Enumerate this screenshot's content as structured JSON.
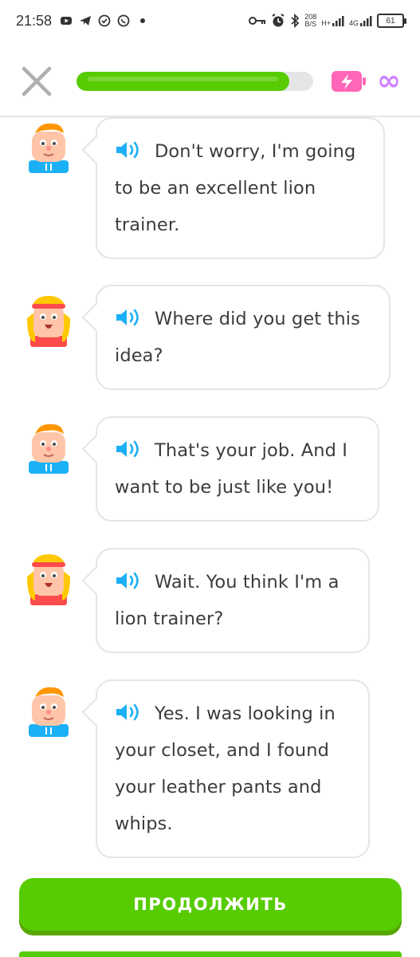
{
  "status_bar": {
    "time": "21:58",
    "data_speed_top": "208",
    "data_speed_bottom": "B/S",
    "network_1": "H+",
    "network_2": "4G",
    "battery": "61"
  },
  "header": {
    "progress_fraction": 0.9,
    "infinity_symbol": "∞"
  },
  "messages": [
    {
      "speaker": "boy",
      "text": "Don't worry, I'm going to be an excellent lion trainer."
    },
    {
      "speaker": "girl",
      "text": "Where did you get this idea?"
    },
    {
      "speaker": "boy",
      "text": "That's your job. And I want to be just like you!"
    },
    {
      "speaker": "girl",
      "text": "Wait. You think I'm a lion trainer?"
    },
    {
      "speaker": "boy",
      "text": "Yes. I was looking in your closet, and I found your leather pants and whips."
    }
  ],
  "continue_button": {
    "label": "ПРОДОЛЖИТЬ"
  },
  "colors": {
    "accent_green": "#58cc02",
    "accent_green_dark": "#58a700",
    "speaker_blue": "#1cb0f6",
    "energy_pink": "#ff66b8",
    "infinity_purple": "#ce82ff"
  }
}
